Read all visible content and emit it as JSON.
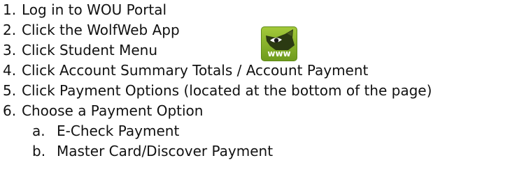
{
  "steps": [
    {
      "number": "1.",
      "text": "Log in to WOU Portal"
    },
    {
      "number": "2.",
      "text": "Click the WolfWeb App"
    },
    {
      "number": "3.",
      "text": "Click Student Menu"
    },
    {
      "number": "4.",
      "text": "Click Account Summary Totals / Account Payment"
    },
    {
      "number": "5.",
      "text": "Click Payment Options (located at the bottom of the page)"
    },
    {
      "number": "6.",
      "text": "Choose a Payment Option"
    }
  ],
  "sub_steps": [
    {
      "letter": "a.",
      "text": "E-Check Payment"
    },
    {
      "letter": "b.",
      "text": "Master Card/Discover Payment"
    }
  ],
  "wolfweb_icon": {
    "icon": "wolf-eye-icon",
    "label": "www",
    "color": "#8bb52a"
  }
}
